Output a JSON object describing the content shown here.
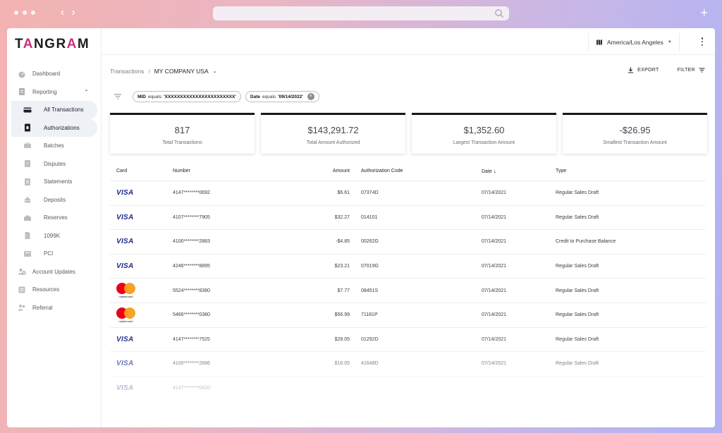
{
  "app": {
    "logo": "TANGRAM"
  },
  "sidebar": {
    "items": [
      {
        "label": "Dashboard",
        "icon": "dashboard-icon"
      },
      {
        "label": "Reporting",
        "icon": "report-icon",
        "expanded": true
      },
      {
        "label": "All Transactions",
        "icon": "card-icon",
        "sub": true,
        "active": true
      },
      {
        "label": "Authorizations",
        "icon": "auth-icon",
        "sub": true,
        "active": true
      },
      {
        "label": "Batches",
        "icon": "batch-icon",
        "sub": true
      },
      {
        "label": "Disputes",
        "icon": "dispute-icon",
        "sub": true
      },
      {
        "label": "Statements",
        "icon": "statement-icon",
        "sub": true
      },
      {
        "label": "Deposits",
        "icon": "deposit-icon",
        "sub": true
      },
      {
        "label": "Reserves",
        "icon": "reserve-icon",
        "sub": true
      },
      {
        "label": "1099K",
        "icon": "document-icon",
        "sub": true
      },
      {
        "label": "PCI",
        "icon": "pci-icon",
        "sub": true
      },
      {
        "label": "Account Updates",
        "icon": "account-updates-icon"
      },
      {
        "label": "Resources",
        "icon": "resources-icon"
      },
      {
        "label": "Referral",
        "icon": "referral-icon"
      }
    ]
  },
  "topbar": {
    "timezone": "America/Los Angeles"
  },
  "breadcrumb": {
    "root": "Transactions",
    "separator": "/",
    "current": "MY COMPANY USA"
  },
  "actions": {
    "export": "EXPORT",
    "filter": "FILTER"
  },
  "filters": {
    "chips": [
      {
        "field": "MID",
        "op": "equals",
        "value": "'XXXXXXXXXXXXXXXXXXXXXXX'"
      },
      {
        "field": "Date",
        "op": "equals",
        "value": "'09/14/2022'"
      }
    ]
  },
  "stats": [
    {
      "value": "817",
      "label": "Total Transactions"
    },
    {
      "value": "$143,291.72",
      "label": "Total Amount Authorized"
    },
    {
      "value": "$1,352.60",
      "label": "Largest Transaction Amount"
    },
    {
      "value": "-$26.95",
      "label": "Smallest Transaction Amount"
    }
  ],
  "table": {
    "columns": {
      "card": "Card",
      "number": "Number",
      "amount": "Amount",
      "auth": "Authorization Code",
      "date": "Date",
      "type": "Type"
    },
    "rows": [
      {
        "card": "VISA",
        "number": "4147********0692",
        "amount": "$6.61",
        "auth": "07374D",
        "date": "07/14/2021",
        "type": "Regular Sales Draft"
      },
      {
        "card": "VISA",
        "number": "4107********7905",
        "amount": "$32.27",
        "auth": "014101",
        "date": "07/14/2021",
        "type": "Regular Sales Draft"
      },
      {
        "card": "VISA",
        "number": "4100********2883",
        "amount": "-$4.85",
        "auth": "00262G",
        "date": "07/14/2021",
        "type": "Credit to Purchase Balance"
      },
      {
        "card": "VISA",
        "number": "4246********8895",
        "amount": "$23.21",
        "auth": "07019G",
        "date": "07/14/2021",
        "type": "Regular Sales Draft"
      },
      {
        "card": "mastercard",
        "number": "5524********8380",
        "amount": "$7.77",
        "auth": "08451S",
        "date": "07/14/2021",
        "type": "Regular Sales Draft"
      },
      {
        "card": "mastercard",
        "number": "5466********0380",
        "amount": "$56.99",
        "auth": "71181P",
        "date": "07/14/2021",
        "type": "Regular Sales Draft"
      },
      {
        "card": "VISA",
        "number": "4147********7525",
        "amount": "$28.05",
        "auth": "01292D",
        "date": "07/14/2021",
        "type": "Regular Sales Draft"
      },
      {
        "card": "VISA",
        "number": "4100********2686",
        "amount": "$18.05",
        "auth": "41648D",
        "date": "07/14/2021",
        "type": "Regular Sales Draft"
      },
      {
        "card": "VISA",
        "number": "4147********0420",
        "amount": "",
        "auth": "",
        "date": "",
        "type": ""
      }
    ]
  }
}
